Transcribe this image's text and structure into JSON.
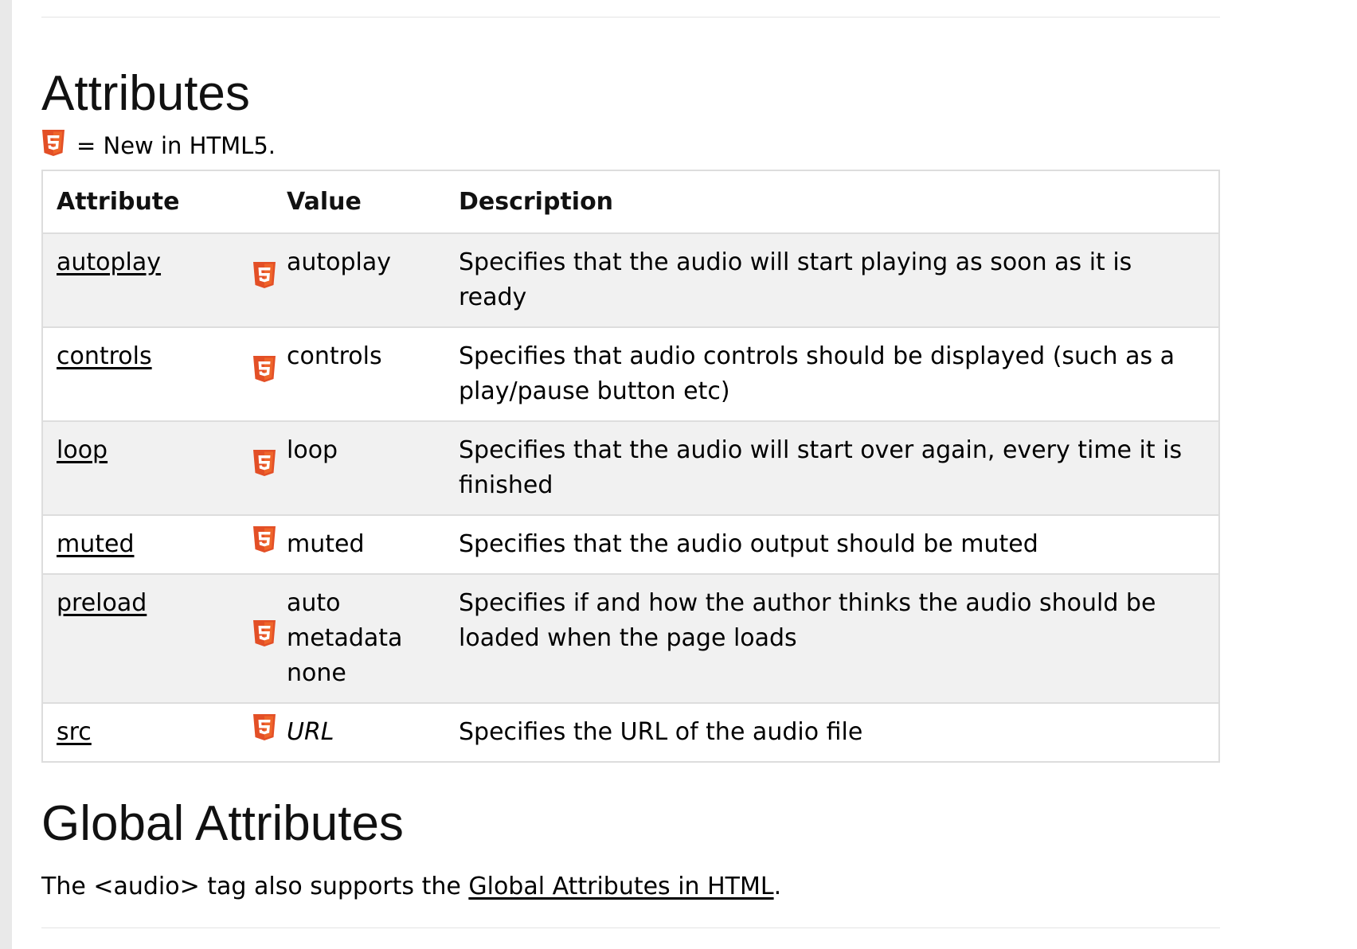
{
  "section_title": "Attributes",
  "legend": {
    "icon": "html5-icon",
    "text": "= New in HTML5."
  },
  "table": {
    "headers": [
      "Attribute",
      "Value",
      "Description"
    ],
    "rows": [
      {
        "attribute": "autoplay",
        "html5": true,
        "value": "autoplay",
        "description": "Specifies that the audio will start playing as soon as it is ready"
      },
      {
        "attribute": "controls",
        "html5": true,
        "value": "controls",
        "description": "Specifies that audio controls should be displayed (such as a play/pause button etc)"
      },
      {
        "attribute": "loop",
        "html5": true,
        "value": "loop",
        "description": "Specifies that the audio will start over again, every time it is finished"
      },
      {
        "attribute": "muted",
        "html5": true,
        "value": "muted",
        "description": "Specifies that the audio output should be muted"
      },
      {
        "attribute": "preload",
        "html5": true,
        "value": [
          "auto",
          "metadata",
          "none"
        ],
        "description": "Specifies if and how the author thinks the audio should be loaded when the page loads"
      },
      {
        "attribute": "src",
        "html5": true,
        "value": "URL",
        "value_style": "italic",
        "description": "Specifies the URL of the audio file"
      }
    ]
  },
  "global": {
    "title": "Global Attributes",
    "text_before": "The <audio> tag also supports the ",
    "link_text": "Global Attributes in HTML",
    "text_after": "."
  },
  "colors": {
    "html5_orange": "#e34f26",
    "row_shade": "#f1f1f1",
    "border": "#dddddd"
  }
}
